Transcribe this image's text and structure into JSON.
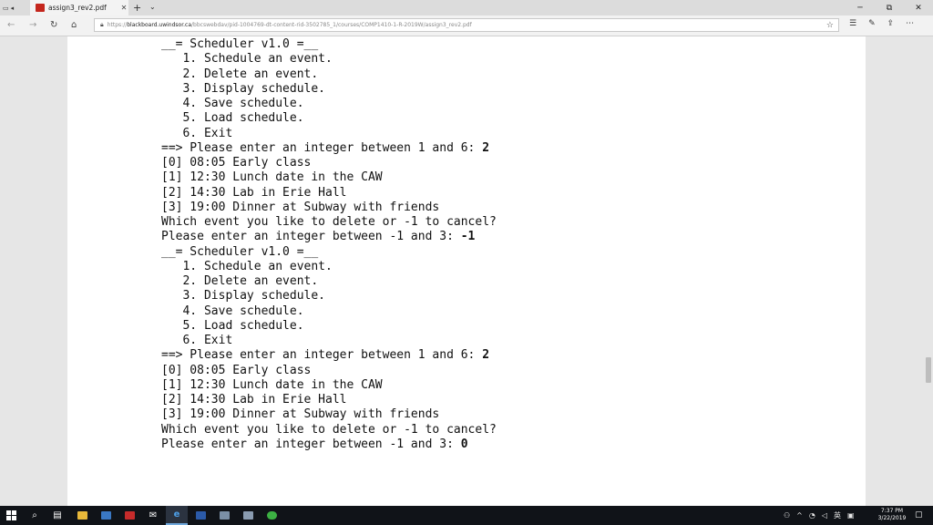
{
  "tabbar": {
    "tab_title": "assign3_rev2.pdf",
    "new_tab_glyph": "+",
    "tab_list_glyph": "⌄",
    "close_glyph": "✕",
    "minimize_glyph": "─",
    "maximize_glyph": "⧉",
    "window_close_glyph": "✕"
  },
  "navbar": {
    "url_prefix": "https://",
    "url_host": "blackboard.uwindsor.ca",
    "url_path": "/bbcswebdav/pid-1004769-dt-content-rid-3502785_1/courses/COMP1410-1-R-2019W/assign3_rev2.pdf"
  },
  "console": {
    "lines": [
      {
        "text": "__= Scheduler v1.0 =__",
        "input": ""
      },
      {
        "text": "   1. Schedule an event.",
        "input": ""
      },
      {
        "text": "   2. Delete an event.",
        "input": ""
      },
      {
        "text": "   3. Display schedule.",
        "input": ""
      },
      {
        "text": "   4. Save schedule.",
        "input": ""
      },
      {
        "text": "   5. Load schedule.",
        "input": ""
      },
      {
        "text": "   6. Exit",
        "input": ""
      },
      {
        "text": "==> Please enter an integer between 1 and 6: ",
        "input": "2"
      },
      {
        "text": "[0] 08:05 Early class",
        "input": ""
      },
      {
        "text": "[1] 12:30 Lunch date in the CAW",
        "input": ""
      },
      {
        "text": "[2] 14:30 Lab in Erie Hall",
        "input": ""
      },
      {
        "text": "[3] 19:00 Dinner at Subway with friends",
        "input": ""
      },
      {
        "text": "Which event you like to delete or -1 to cancel?",
        "input": ""
      },
      {
        "text": "Please enter an integer between -1 and 3: ",
        "input": "-1"
      },
      {
        "text": "__= Scheduler v1.0 =__",
        "input": ""
      },
      {
        "text": "   1. Schedule an event.",
        "input": ""
      },
      {
        "text": "   2. Delete an event.",
        "input": ""
      },
      {
        "text": "   3. Display schedule.",
        "input": ""
      },
      {
        "text": "   4. Save schedule.",
        "input": ""
      },
      {
        "text": "   5. Load schedule.",
        "input": ""
      },
      {
        "text": "   6. Exit",
        "input": ""
      },
      {
        "text": "==> Please enter an integer between 1 and 6: ",
        "input": "2"
      },
      {
        "text": "[0] 08:05 Early class",
        "input": ""
      },
      {
        "text": "[1] 12:30 Lunch date in the CAW",
        "input": ""
      },
      {
        "text": "[2] 14:30 Lab in Erie Hall",
        "input": ""
      },
      {
        "text": "[3] 19:00 Dinner at Subway with friends",
        "input": ""
      },
      {
        "text": "Which event you like to delete or -1 to cancel?",
        "input": ""
      },
      {
        "text": "Please enter an integer between -1 and 3: ",
        "input": "0"
      }
    ]
  },
  "taskbar": {
    "time": "7:37 PM",
    "date": "3/22/2019"
  },
  "colors": {
    "taskbar_bg": "#101318",
    "page_bg": "#ffffff",
    "viewer_bg": "#e6e6e6",
    "pdf_icon": "#c4261d"
  }
}
